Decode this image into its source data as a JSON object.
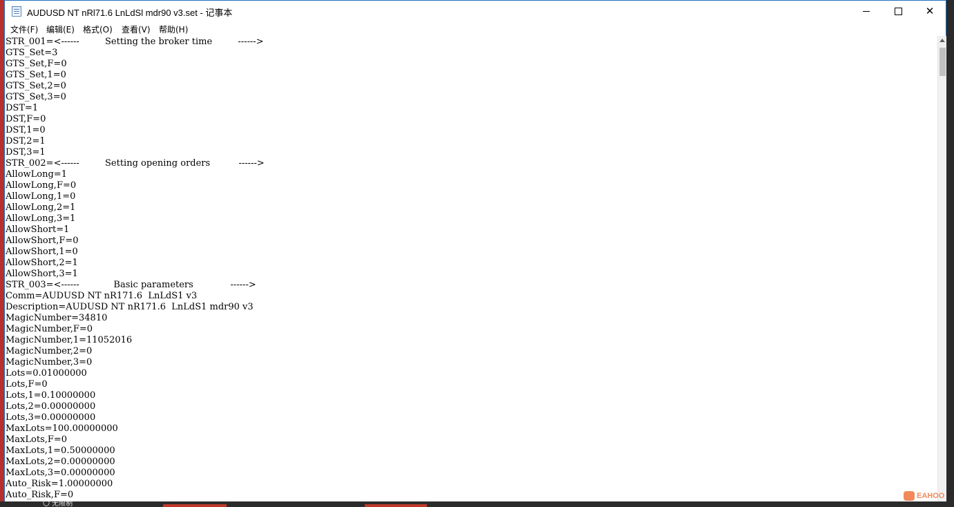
{
  "window": {
    "title": "AUDUSD NT nRl71.6  LnLdSl mdr90 v3.set - 记事本",
    "controls": {
      "close_glyph": "✕"
    }
  },
  "menu": [
    "文件(F)",
    "编辑(E)",
    "格式(O)",
    "查看(V)",
    "帮助(H)"
  ],
  "editor": {
    "lines": [
      "STR_001=<------         Setting the broker time         ------>",
      "GTS_Set=3",
      "GTS_Set,F=0",
      "GTS_Set,1=0",
      "GTS_Set,2=0",
      "GTS_Set,3=0",
      "DST=1",
      "DST,F=0",
      "DST,1=0",
      "DST,2=1",
      "DST,3=1",
      "STR_002=<------         Setting opening orders          ------>",
      "AllowLong=1",
      "AllowLong,F=0",
      "AllowLong,1=0",
      "AllowLong,2=1",
      "AllowLong,3=1",
      "AllowShort=1",
      "AllowShort,F=0",
      "AllowShort,1=0",
      "AllowShort,2=1",
      "AllowShort,3=1",
      "STR_003=<------            Basic parameters             ------>",
      "Comm=AUDUSD NT nR171.6  LnLdS1 v3",
      "Description=AUDUSD NT nR171.6  LnLdS1 mdr90 v3",
      "MagicNumber=34810",
      "MagicNumber,F=0",
      "MagicNumber,1=11052016",
      "MagicNumber,2=0",
      "MagicNumber,3=0",
      "Lots=0.01000000",
      "Lots,F=0",
      "Lots,1=0.10000000",
      "Lots,2=0.00000000",
      "Lots,3=0.00000000",
      "MaxLots=100.00000000",
      "MaxLots,F=0",
      "MaxLots,1=0.50000000",
      "MaxLots,2=0.00000000",
      "MaxLots,3=0.00000000",
      "Auto_Risk=1.00000000",
      "Auto_Risk,F=0"
    ]
  },
  "taskbar": {
    "label": "〇 无限制"
  },
  "watermark": "EAHOO"
}
